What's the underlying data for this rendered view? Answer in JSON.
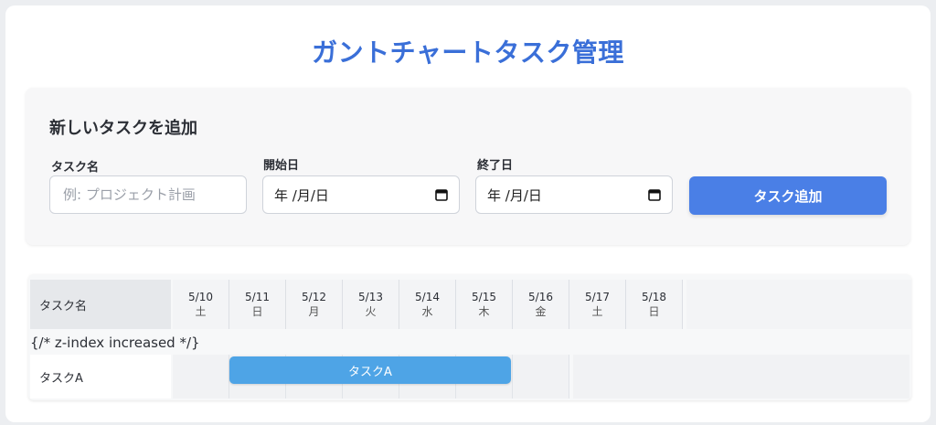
{
  "app": {
    "title": "ガントチャートタスク管理"
  },
  "form": {
    "title": "新しいタスクを追加",
    "task_name": {
      "label": "タスク名",
      "placeholder": "例: プロジェクト計画"
    },
    "start_date": {
      "label": "開始日",
      "value": "年 /月/日"
    },
    "end_date": {
      "label": "終了日",
      "value": "年 /月/日"
    },
    "add_button_label": "タスク追加"
  },
  "gantt": {
    "header_name_label": "タスク名",
    "dates": [
      {
        "date": "5/10",
        "dow": "土"
      },
      {
        "date": "5/11",
        "dow": "日"
      },
      {
        "date": "5/12",
        "dow": "月"
      },
      {
        "date": "5/13",
        "dow": "火"
      },
      {
        "date": "5/14",
        "dow": "水"
      },
      {
        "date": "5/15",
        "dow": "木"
      },
      {
        "date": "5/16",
        "dow": "金"
      },
      {
        "date": "5/17",
        "dow": "土"
      },
      {
        "date": "5/18",
        "dow": "日"
      }
    ],
    "stray_text": "{/* z-index increased */}",
    "tasks": [
      {
        "name": "タスクA",
        "bar_label": "タスクA",
        "start_day_index": 1,
        "end_day_index": 5
      }
    ]
  },
  "colors": {
    "accent": "#3a6fd8",
    "button": "#4a7fe6",
    "bar": "#4ea4e6"
  }
}
